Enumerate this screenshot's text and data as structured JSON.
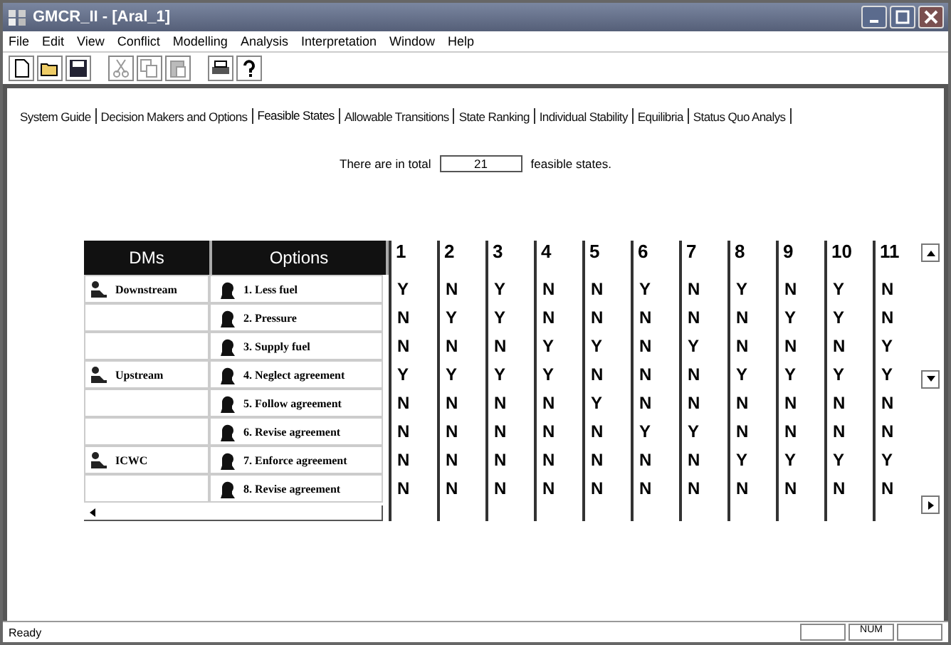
{
  "window": {
    "title": "GMCR_II - [Aral_1]"
  },
  "menu": [
    "File",
    "Edit",
    "View",
    "Conflict",
    "Modelling",
    "Analysis",
    "Interpretation",
    "Window",
    "Help"
  ],
  "tabs": [
    {
      "label": "System Guide",
      "selected": false
    },
    {
      "label": "Decision Makers and Options",
      "selected": false
    },
    {
      "label": "Feasible States",
      "selected": true
    },
    {
      "label": "Allowable Transitions",
      "selected": false
    },
    {
      "label": "State Ranking",
      "selected": false
    },
    {
      "label": "Individual Stability",
      "selected": false
    },
    {
      "label": "Equilibria",
      "selected": false
    },
    {
      "label": "Status Quo Analys",
      "selected": false
    }
  ],
  "summary": {
    "before": "There are in total",
    "count": "21",
    "after": "feasible states."
  },
  "table": {
    "columns": [
      "DMs",
      "Options"
    ],
    "states": [
      "1",
      "2",
      "3",
      "4",
      "5",
      "6",
      "7",
      "8",
      "9",
      "10",
      "11"
    ],
    "rows": [
      {
        "dm": "Downstream",
        "option": "1. Less fuel",
        "values": [
          "Y",
          "N",
          "Y",
          "N",
          "N",
          "Y",
          "N",
          "Y",
          "N",
          "Y",
          "N"
        ]
      },
      {
        "option": "2. Pressure",
        "values": [
          "N",
          "Y",
          "Y",
          "N",
          "N",
          "N",
          "N",
          "N",
          "Y",
          "Y",
          "N"
        ]
      },
      {
        "option": "3. Supply fuel",
        "values": [
          "N",
          "N",
          "N",
          "Y",
          "Y",
          "N",
          "Y",
          "N",
          "N",
          "N",
          "Y"
        ]
      },
      {
        "dm": "Upstream",
        "option": "4. Neglect agreement",
        "values": [
          "Y",
          "Y",
          "Y",
          "Y",
          "N",
          "N",
          "N",
          "Y",
          "Y",
          "Y",
          "Y"
        ]
      },
      {
        "option": "5. Follow agreement",
        "values": [
          "N",
          "N",
          "N",
          "N",
          "Y",
          "N",
          "N",
          "N",
          "N",
          "N",
          "N"
        ]
      },
      {
        "option": "6. Revise agreement",
        "values": [
          "N",
          "N",
          "N",
          "N",
          "N",
          "Y",
          "Y",
          "N",
          "N",
          "N",
          "N"
        ]
      },
      {
        "dm": "ICWC",
        "option": "7. Enforce agreement",
        "values": [
          "N",
          "N",
          "N",
          "N",
          "N",
          "N",
          "N",
          "Y",
          "Y",
          "Y",
          "Y"
        ]
      },
      {
        "option": "8. Revise agreement",
        "values": [
          "N",
          "N",
          "N",
          "N",
          "N",
          "N",
          "N",
          "N",
          "N",
          "N",
          "N"
        ]
      }
    ]
  },
  "status_bar": {
    "text": "Ready",
    "indicator": "NUM"
  }
}
